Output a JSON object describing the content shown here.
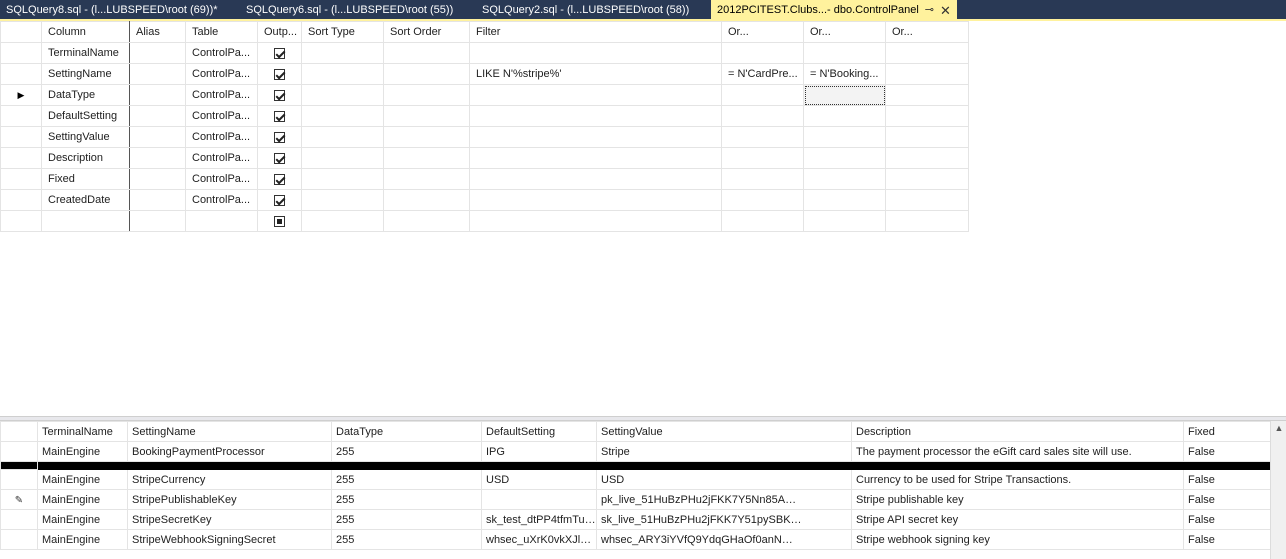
{
  "tabs": [
    {
      "label": "SQLQuery8.sql - (l...LUBSPEED\\root (69))*"
    },
    {
      "label": "SQLQuery6.sql - (l...LUBSPEED\\root (55))"
    },
    {
      "label": "SQLQuery2.sql - (l...LUBSPEED\\root (58))"
    },
    {
      "label": "2012PCITEST.Clubs...- dbo.ControlPanel",
      "active": true
    }
  ],
  "criteria": {
    "headers": [
      "Column",
      "Alias",
      "Table",
      "Outp...",
      "Sort Type",
      "Sort Order",
      "Filter",
      "Or...",
      "Or...",
      "Or..."
    ],
    "rows": [
      {
        "column": "TerminalName",
        "alias": "",
        "table": "ControlPa...",
        "output": true,
        "sort_type": "",
        "sort_order": "",
        "filter": "",
        "or1": "",
        "or2": "",
        "or3": ""
      },
      {
        "column": "SettingName",
        "alias": "",
        "table": "ControlPa...",
        "output": true,
        "sort_type": "",
        "sort_order": "",
        "filter": "LIKE N'%stripe%'",
        "or1": "= N'CardPre...",
        "or2": "= N'Booking...",
        "or3": ""
      },
      {
        "column": "DataType",
        "alias": "",
        "table": "ControlPa...",
        "output": true,
        "sort_type": "",
        "sort_order": "",
        "filter": "",
        "or1": "",
        "or2": "",
        "or3": ""
      },
      {
        "column": "DefaultSetting",
        "alias": "",
        "table": "ControlPa...",
        "output": true,
        "sort_type": "",
        "sort_order": "",
        "filter": "",
        "or1": "",
        "or2": "",
        "or3": ""
      },
      {
        "column": "SettingValue",
        "alias": "",
        "table": "ControlPa...",
        "output": true,
        "sort_type": "",
        "sort_order": "",
        "filter": "",
        "or1": "",
        "or2": "",
        "or3": ""
      },
      {
        "column": "Description",
        "alias": "",
        "table": "ControlPa...",
        "output": true,
        "sort_type": "",
        "sort_order": "",
        "filter": "",
        "or1": "",
        "or2": "",
        "or3": ""
      },
      {
        "column": "Fixed",
        "alias": "",
        "table": "ControlPa...",
        "output": true,
        "sort_type": "",
        "sort_order": "",
        "filter": "",
        "or1": "",
        "or2": "",
        "or3": ""
      },
      {
        "column": "CreatedDate",
        "alias": "",
        "table": "ControlPa...",
        "output": true,
        "sort_type": "",
        "sort_order": "",
        "filter": "",
        "or1": "",
        "or2": "",
        "or3": ""
      }
    ]
  },
  "results": {
    "headers": [
      "TerminalName",
      "SettingName",
      "DataType",
      "DefaultSetting",
      "SettingValue",
      "Description",
      "Fixed"
    ],
    "rows": [
      {
        "terminal": "MainEngine",
        "setting": "BookingPaymentProcessor",
        "datatype": "255",
        "default": "IPG",
        "value": "Stripe",
        "description": "The payment processor the eGift card sales site will use.",
        "fixed": "False"
      },
      {
        "terminal": "MainEngine",
        "setting": "StripeCurrency",
        "datatype": "255",
        "default": "USD",
        "value": "USD",
        "description": "Currency to be used for Stripe Transactions.",
        "fixed": "False"
      },
      {
        "terminal": "MainEngine",
        "setting": "StripePublishableKey",
        "datatype": "255",
        "default": "",
        "value": "pk_live_51HuBzPHu2jFKK7Y5Nn85A",
        "description": "Stripe publishable key",
        "fixed": "False"
      },
      {
        "terminal": "MainEngine",
        "setting": "StripeSecretKey",
        "datatype": "255",
        "default": "sk_test_dtPP4tfmTul...",
        "value": "sk_live_51HuBzPHu2jFKK7Y51pySBK",
        "description": "Stripe API secret key",
        "fixed": "False"
      },
      {
        "terminal": "MainEngine",
        "setting": "StripeWebhookSigningSecret",
        "datatype": "255",
        "default": "whsec_uXrK0vkXJlCd...",
        "value": "whsec_ARY3iYVfQ9YdqGHaOf0anN",
        "description": "Stripe webhook signing key",
        "fixed": "False"
      }
    ]
  },
  "colors": {
    "tab_bg": "#293955",
    "active_tab": "#fff29d"
  }
}
